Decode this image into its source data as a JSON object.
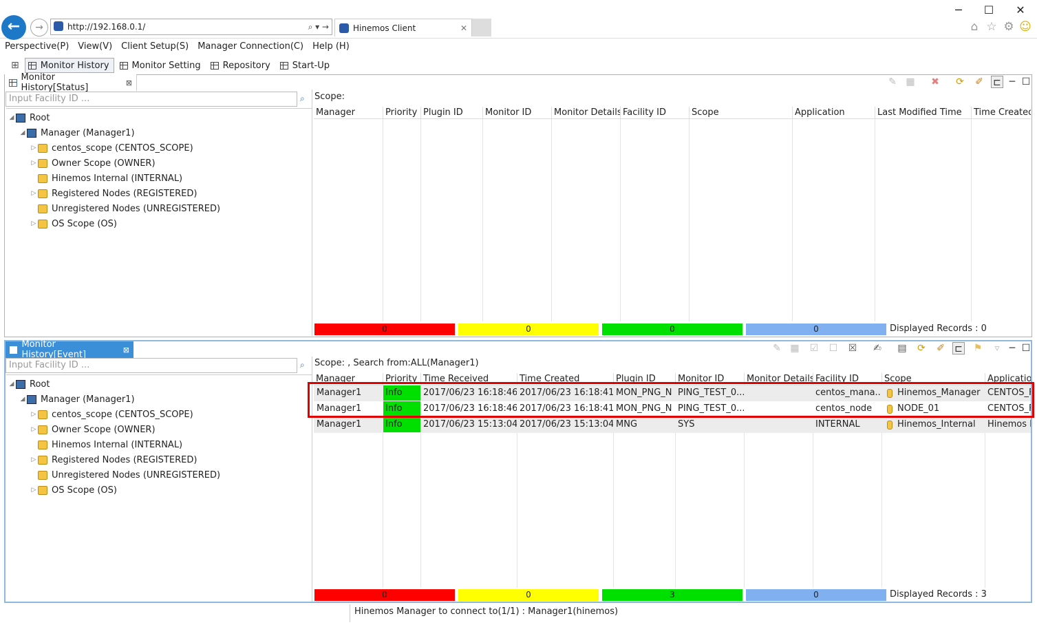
{
  "browser": {
    "url": "http://192.168.0.1/",
    "address_tools": "⌕ ▾ →",
    "tab_title": "Hinemos Client"
  },
  "menu": [
    "Perspective(P)",
    "View(V)",
    "Client Setup(S)",
    "Manager Connection(C)",
    "Help (H)"
  ],
  "perspectives": [
    "Monitor History",
    "Monitor Setting",
    "Repository",
    "Start-Up"
  ],
  "status_view": {
    "tab_title": "Monitor History[Status]",
    "filter_placeholder": "Input Facility ID ...",
    "scope_label": "Scope:",
    "columns": [
      "Manager",
      "Priority",
      "Plugin ID",
      "Monitor ID",
      "Monitor Details",
      "Facility ID",
      "Scope",
      "Application",
      "Last Modified Time",
      "Time Created"
    ],
    "counts": {
      "critical": "0",
      "warning": "0",
      "info": "0",
      "unknown": "0"
    },
    "displayed_records": "Displayed Records : 0"
  },
  "tree": {
    "root": "Root",
    "manager": "Manager (Manager1)",
    "items": [
      {
        "label": "centos_scope (CENTOS_SCOPE)",
        "expandable": true
      },
      {
        "label": "Owner Scope (OWNER)",
        "expandable": true
      },
      {
        "label": "Hinemos Internal (INTERNAL)",
        "expandable": false
      },
      {
        "label": "Registered Nodes (REGISTERED)",
        "expandable": true
      },
      {
        "label": "Unregistered Nodes (UNREGISTERED)",
        "expandable": false
      },
      {
        "label": "OS Scope (OS)",
        "expandable": true
      }
    ]
  },
  "event_view": {
    "tab_title": "Monitor History[Event]",
    "filter_placeholder": "Input Facility ID ...",
    "scope_label": "Scope: ,    Search from:ALL(Manager1)",
    "columns": [
      "Manager",
      "Priority",
      "Time Received",
      "Time Created",
      "Plugin ID",
      "Monitor ID",
      "Monitor Details",
      "Facility ID",
      "Scope",
      "Application"
    ],
    "rows": [
      {
        "manager": "Manager1",
        "priority": "Info",
        "received": "2017/06/23 16:18:46",
        "created": "2017/06/23 16:18:41",
        "plugin": "MON_PNG_N",
        "monitor": "PING_TEST_0...",
        "details": "",
        "facility": "centos_mana...",
        "scope": "Hinemos_Manager",
        "app": "CENTOS_F"
      },
      {
        "manager": "Manager1",
        "priority": "Info",
        "received": "2017/06/23 16:18:46",
        "created": "2017/06/23 16:18:41",
        "plugin": "MON_PNG_N",
        "monitor": "PING_TEST_0...",
        "details": "",
        "facility": "centos_node",
        "scope": "NODE_01",
        "app": "CENTOS_F"
      },
      {
        "manager": "Manager1",
        "priority": "Info",
        "received": "2017/06/23 15:13:04",
        "created": "2017/06/23 15:13:04",
        "plugin": "MNG",
        "monitor": "SYS",
        "details": "",
        "facility": "INTERNAL",
        "scope": "Hinemos_Internal",
        "app": "Hinemos M"
      }
    ],
    "counts": {
      "critical": "0",
      "warning": "0",
      "info": "3",
      "unknown": "0"
    },
    "displayed_records": "Displayed Records : 3"
  },
  "status_bar": "Hinemos Manager to connect to(1/1) : Manager1(hinemos)",
  "colors": {
    "critical": "#ff0000",
    "warning": "#ffff00",
    "info": "#00e000",
    "unknown": "#80b0f0",
    "highlight": "#e00000",
    "accent": "#1e78c8"
  }
}
